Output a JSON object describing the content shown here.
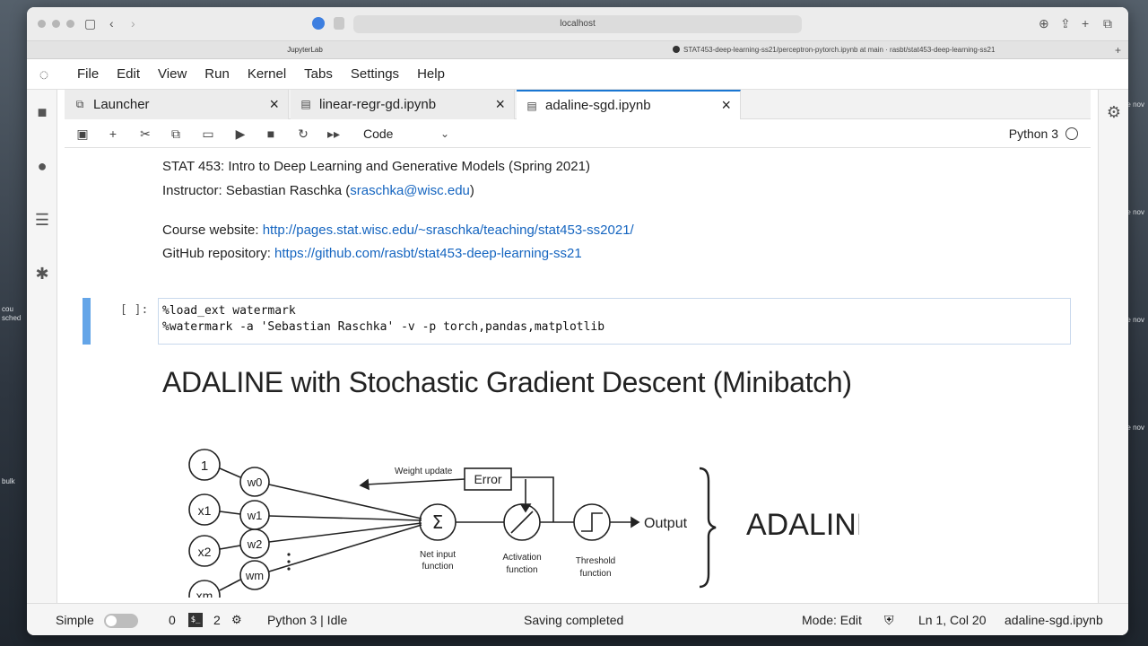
{
  "browser": {
    "url": "localhost",
    "active_tab": "JupyterLab",
    "other_tab": "STAT453-deep-learning-ss21/perceptron-pytorch.ipynb at main · rasbt/stat453-deep-learning-ss21"
  },
  "menu": [
    "File",
    "Edit",
    "View",
    "Run",
    "Kernel",
    "Tabs",
    "Settings",
    "Help"
  ],
  "tabs": [
    {
      "label": "Launcher"
    },
    {
      "label": "linear-regr-gd.ipynb"
    },
    {
      "label": "adaline-sgd.ipynb"
    }
  ],
  "toolbar": {
    "cell_type": "Code",
    "kernel": "Python 3"
  },
  "notebook": {
    "line1": "STAT 453: Intro to Deep Learning and Generative Models (Spring 2021)",
    "instructor_prefix": "Instructor: Sebastian Raschka (",
    "instructor_email": "sraschka@wisc.edu",
    "instructor_suffix": ")",
    "website_prefix": "Course website: ",
    "website_url": "http://pages.stat.wisc.edu/~sraschka/teaching/stat453-ss2021/",
    "github_prefix": "GitHub repository: ",
    "github_url": "https://github.com/rasbt/stat453-deep-learning-ss21",
    "cell_prompt": "[ ]:",
    "code_line1": "%load_ext watermark",
    "code_line2": "%watermark -a 'Sebastian Raschka' -v -p torch,pandas,matplotlib",
    "heading": "ADALINE with Stochastic Gradient Descent (Minibatch)"
  },
  "diagram": {
    "input_one": "1",
    "inputs": [
      "x1",
      "x2",
      "xm"
    ],
    "weights": [
      "w0",
      "w1",
      "w2",
      "wm"
    ],
    "weight_update": "Weight update",
    "error": "Error",
    "net_input_1": "Net input",
    "net_input_2": "function",
    "activation_1": "Activation",
    "activation_2": "function",
    "threshold_1": "Threshold",
    "threshold_2": "function",
    "output": "Output",
    "big_label": "ADALINE"
  },
  "status": {
    "mode_simple": "Simple",
    "count_a": "0",
    "count_b": "2",
    "kernel_status": "Python 3 | Idle",
    "saving": "Saving completed",
    "mode": "Mode: Edit",
    "cursor": "Ln 1, Col 20",
    "filename": "adaline-sgd.ipynb"
  },
  "desktop": {
    "left_labels": [
      "cou",
      "sched",
      "bulk"
    ],
    "right_label": "re\nnov"
  }
}
